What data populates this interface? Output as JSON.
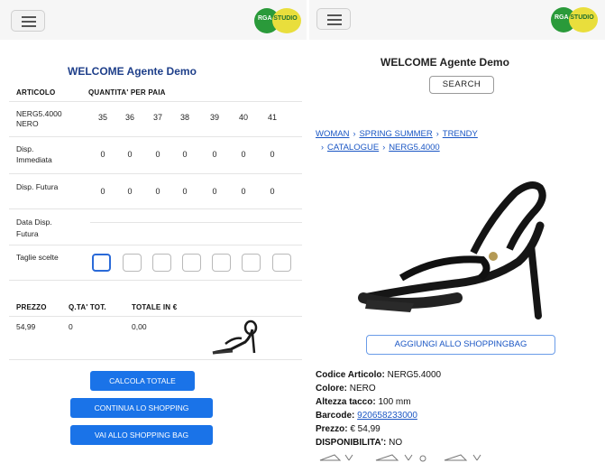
{
  "left": {
    "welcome": "WELCOME Agente Demo",
    "headers": {
      "articolo": "ARTICOLO",
      "quantita": "QUANTITA' PER PAIA"
    },
    "article_code": "NERG5.4000",
    "article_color": "NERO",
    "sizes": [
      "35",
      "36",
      "37",
      "38",
      "39",
      "40",
      "41"
    ],
    "disp_immediata": {
      "label_1": "Disp.",
      "label_2": "Immediata",
      "values": [
        "0",
        "0",
        "0",
        "0",
        "0",
        "0",
        "0"
      ]
    },
    "disp_futura": {
      "label": "Disp. Futura",
      "values": [
        "0",
        "0",
        "0",
        "0",
        "0",
        "0",
        "0"
      ]
    },
    "data_disp": {
      "label_1": "Data Disp.",
      "label_2": "Futura"
    },
    "taglie": {
      "label": "Taglie scelte",
      "count": 7,
      "active_index": 0
    },
    "totals_headers": {
      "prezzo": "PREZZO",
      "qta": "Q.TA' TOT.",
      "totale": "TOTALE IN €"
    },
    "totals_values": {
      "prezzo": "54,99",
      "qta": "0",
      "totale": "0,00"
    },
    "buttons": {
      "calcola": "CALCOLA TOTALE",
      "continua": "CONTINUA LO SHOPPING",
      "vai": "VAI ALLO SHOPPING BAG"
    }
  },
  "logo": {
    "part1": "RGA",
    "part2": "STUDIO"
  },
  "right": {
    "welcome": "WELCOME Agente Demo",
    "search_label": "SEARCH",
    "breadcrumb": [
      "WOMAN",
      "SPRING SUMMER",
      "TRENDY",
      "CATALOGUE",
      "NERG5.4000"
    ],
    "add_to_bag": "AGGIUNGI ALLO SHOPPINGBAG",
    "details": {
      "codice_label": "Codice Articolo:",
      "codice_value": "NERG5.4000",
      "colore_label": "Colore:",
      "colore_value": "NERO",
      "altezza_label": "Altezza tacco:",
      "altezza_value": "100 mm",
      "barcode_label": "Barcode:",
      "barcode_value": "920658233000",
      "prezzo_label": "Prezzo:",
      "prezzo_value": "€ 54,99",
      "disp_label": "DISPONIBILITA':",
      "disp_value": "NO"
    }
  },
  "colors": {
    "accent": "#1a73e8",
    "link": "#1a56c4",
    "title": "#1e3f8a"
  }
}
